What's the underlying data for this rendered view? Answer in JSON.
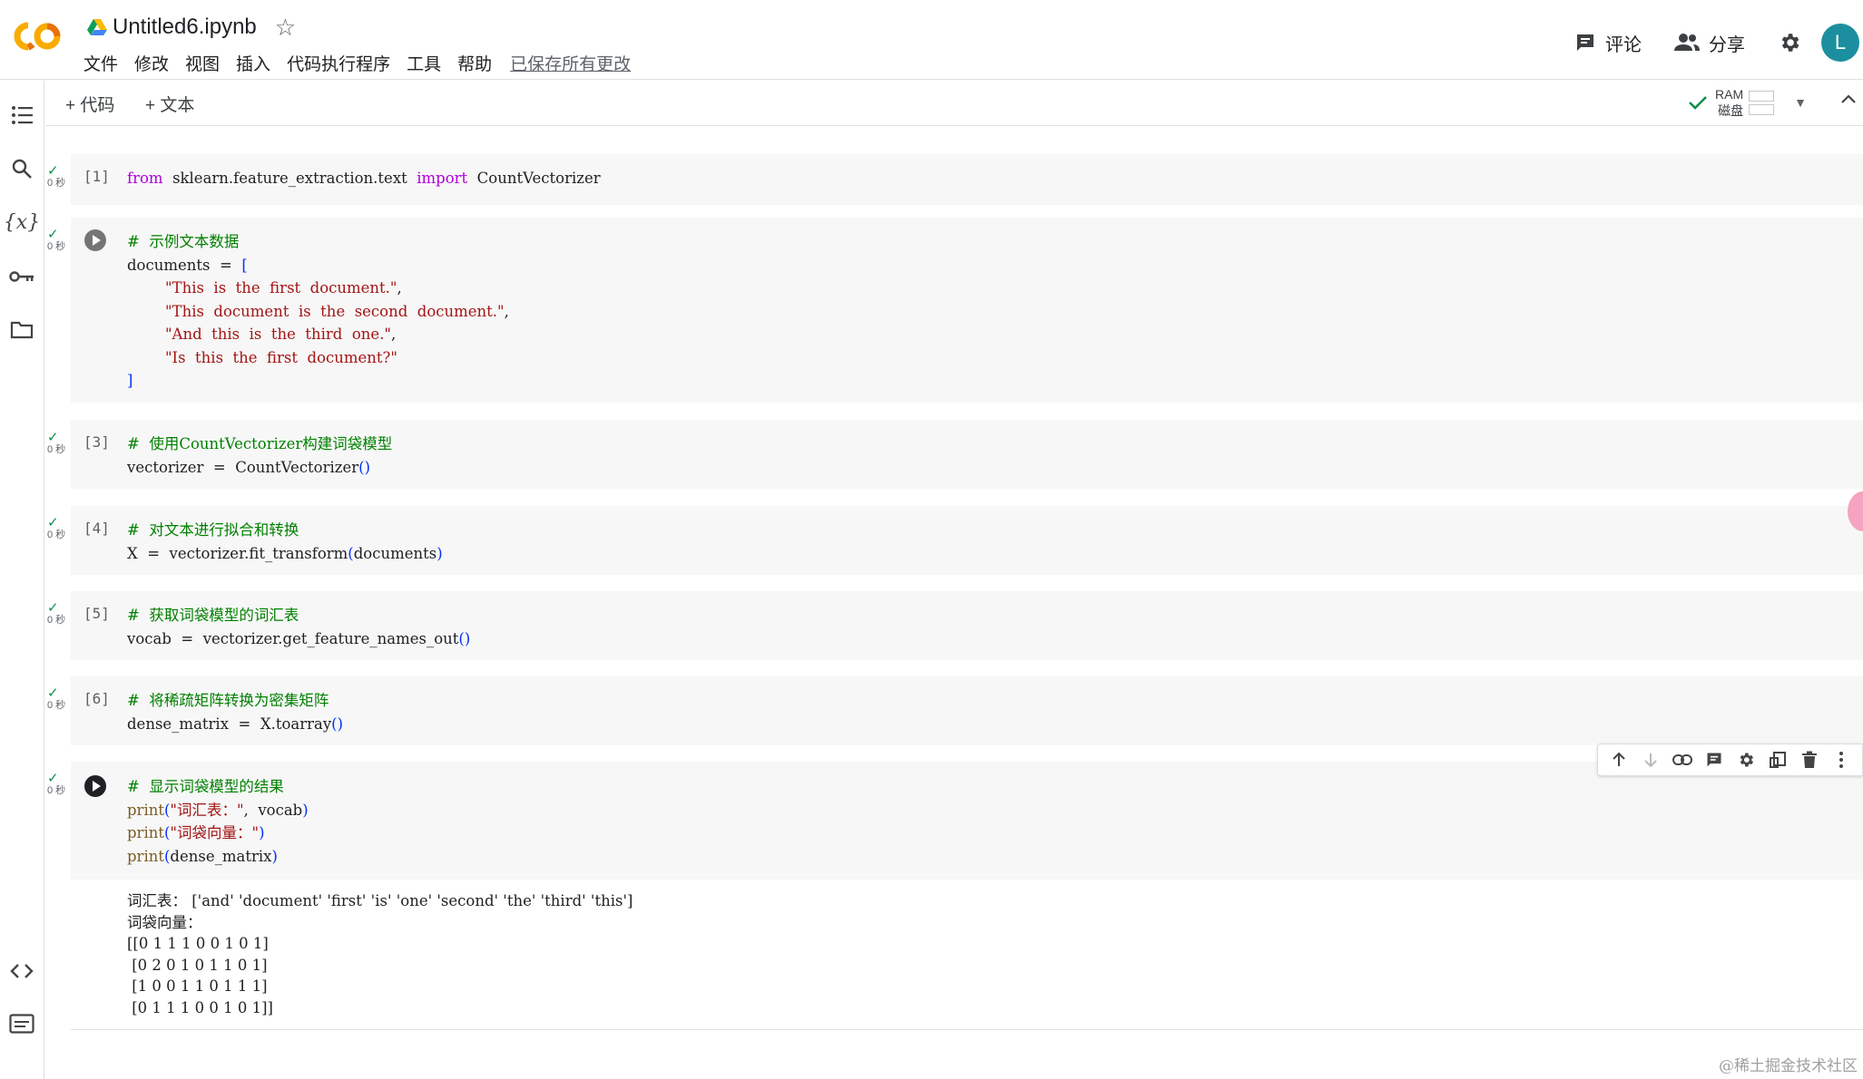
{
  "header": {
    "title": "Untitled6.ipynb",
    "menu": [
      "文件",
      "修改",
      "视图",
      "插入",
      "代码执行程序",
      "工具",
      "帮助"
    ],
    "saved_status": "已保存所有更改",
    "comment_label": "评论",
    "share_label": "分享",
    "avatar_letter": "L"
  },
  "toolbar": {
    "add_code": "+ 代码",
    "add_text": "+ 文本",
    "ram_label": "RAM",
    "disk_label": "磁盘"
  },
  "cells": [
    {
      "count": "[1]",
      "status_time": "0 秒",
      "code": "from sklearn.feature_extraction.text import CountVectorizer"
    },
    {
      "count": "",
      "status_time": "0 秒",
      "code_lines": [
        "# 示例文本数据",
        "documents = [",
        "    \"This is the first document.\",",
        "    \"This document is the second document.\",",
        "    \"And this is the third one.\",",
        "    \"Is this the first document?\"",
        "]"
      ]
    },
    {
      "count": "[3]",
      "status_time": "0 秒",
      "code_lines": [
        "# 使用CountVectorizer构建词袋模型",
        "vectorizer = CountVectorizer()"
      ]
    },
    {
      "count": "[4]",
      "status_time": "0 秒",
      "code_lines": [
        "# 对文本进行拟合和转换",
        "X = vectorizer.fit_transform(documents)"
      ]
    },
    {
      "count": "[5]",
      "status_time": "0 秒",
      "code_lines": [
        "# 获取词袋模型的词汇表",
        "vocab = vectorizer.get_feature_names_out()"
      ]
    },
    {
      "count": "[6]",
      "status_time": "0 秒",
      "code_lines": [
        "# 将稀疏矩阵转换为密集矩阵",
        "dense_matrix = X.toarray()"
      ]
    },
    {
      "count": "",
      "status_time": "0 秒",
      "code_lines": [
        "# 显示词袋模型的结果",
        "print(\"词汇表：\", vocab)",
        "print(\"词袋向量：\")",
        "print(dense_matrix)"
      ],
      "output_lines": [
        "词汇表： ['and' 'document' 'first' 'is' 'one' 'second' 'the' 'third' 'this']",
        "词袋向量：",
        "[[0 1 1 1 0 0 1 0 1]",
        " [0 2 0 1 0 1 1 0 1]",
        " [1 0 0 1 1 0 1 1 1]",
        " [0 1 1 1 0 0 1 0 1]]"
      ]
    }
  ],
  "watermark": "@稀土掘金技术社区",
  "colors": {
    "keyword": "#af00db",
    "comment": "#008000",
    "string": "#a31515",
    "check": "#0d904f",
    "avatar": "#1b8fa0",
    "logo_orange": "#f9ab00",
    "logo_dark_orange": "#e8710a"
  }
}
